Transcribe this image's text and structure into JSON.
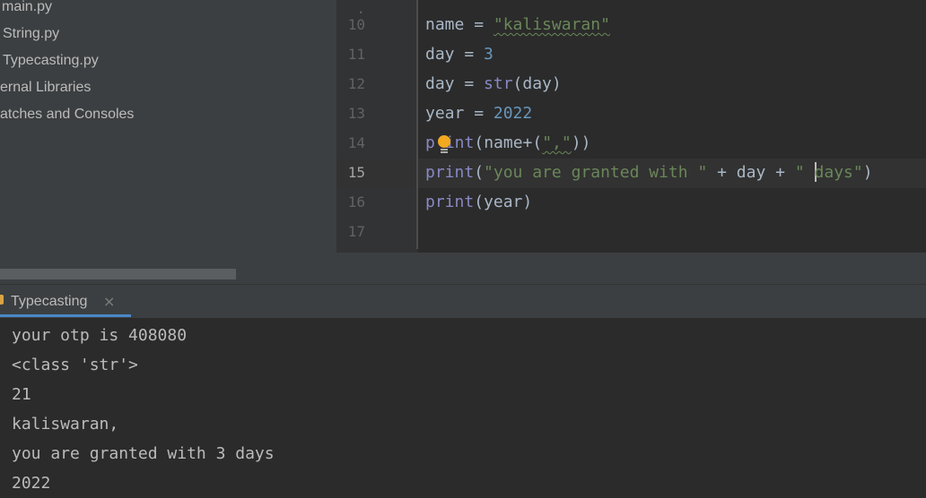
{
  "project_tree": {
    "items": [
      {
        "label": "main.py"
      },
      {
        "label": "String.py"
      },
      {
        "label": "Typecasting.py"
      },
      {
        "label": "ernal Libraries"
      },
      {
        "label": "atches and Consoles"
      }
    ]
  },
  "editor": {
    "line_numbers": [
      "10",
      "11",
      "12",
      "13",
      "14",
      "15",
      "16",
      "17"
    ],
    "current_line": "15",
    "code": {
      "l10": {
        "name": "name",
        "op": " = ",
        "str": "\"kaliswaran\""
      },
      "l11": {
        "name": "day",
        "op": " = ",
        "num": "3"
      },
      "l12": {
        "name": "day",
        "op": " = ",
        "fn": "str",
        "rest": "(day)"
      },
      "l13": {
        "name": "year",
        "op": " = ",
        "num": "2022"
      },
      "l14": {
        "fn_a": "p",
        "fn_b": "int",
        "open": "(name+(",
        "str": "\",\"",
        "close": "))"
      },
      "l15": {
        "fn": "print",
        "open": "(",
        "str_a": "\"you are granted with \"",
        "mid": " + day + ",
        "str_b1": "\" ",
        "str_b2": "days\"",
        "close": ")"
      },
      "l16": {
        "fn": "print",
        "rest": "(year)"
      }
    }
  },
  "run_panel": {
    "tab_label": "Typecasting",
    "close_glyph": "×"
  },
  "console": {
    "lines": [
      "your otp is 408080",
      "<class 'str'>",
      "21",
      "kaliswaran,",
      "you are granted with 3 days",
      "2022"
    ]
  },
  "colors": {
    "string": "#6a8759",
    "number": "#6897bb",
    "builtin": "#8888c6",
    "text": "#a9b7c6",
    "accent": "#4a88c7"
  }
}
